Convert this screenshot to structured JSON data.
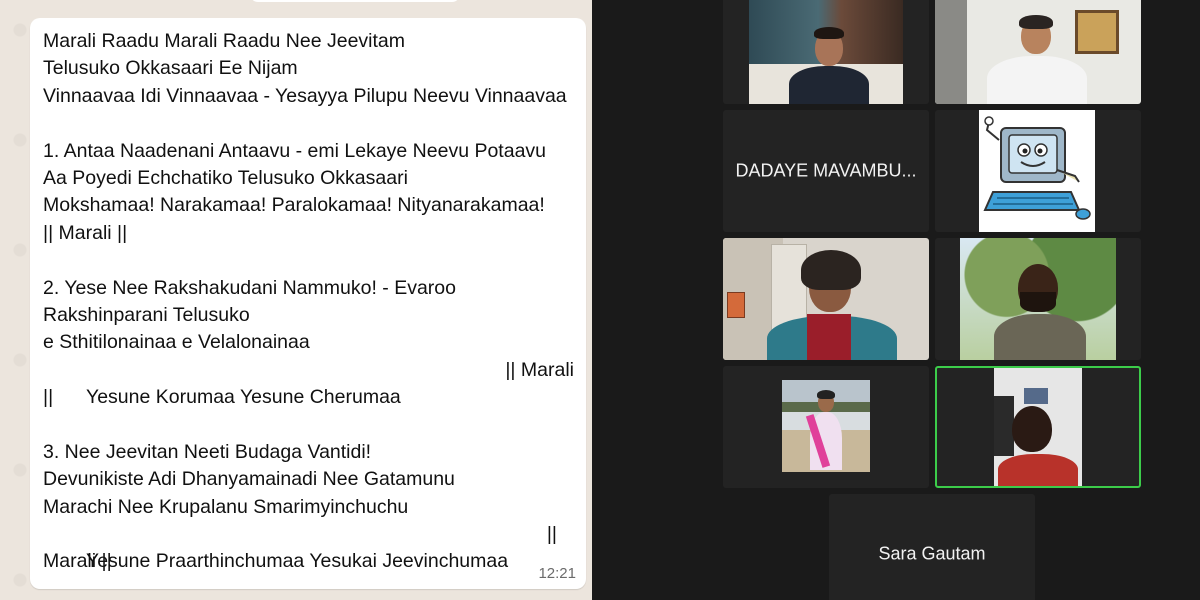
{
  "chat": {
    "message_lines": [
      "Marali Raadu Marali Raadu Nee Jeevitam",
      "Telusuko Okkasaari Ee Nijam",
      "Vinnaavaa Idi Vinnaavaa - Yesayya Pilupu Neevu Vinnaavaa",
      "",
      "1. Antaa Naadenani Antaavu - emi Lekaye Neevu Potaavu",
      "Aa Poyedi Echchatiko Telusuko Okkasaari",
      "Mokshamaa! Narakamaa! Paralokamaa! Nityanarakamaa!",
      "|| Marali ||",
      "",
      "2. Yese Nee Rakshakudani Nammuko! - Evaroo",
      "Rakshinparani Telusuko",
      "e Sthitilonainaa e Velalonainaa"
    ],
    "line_yesune_korumaa_left": "Yesune Korumaa Yesune Cherumaa",
    "line_yesune_korumaa_right": "|| Marali",
    "line_bars": "||",
    "message_lines_2": [
      "",
      "3. Nee Jeevitan Neeti Budaga Vantidi!",
      "Devunikiste Adi Dhanyamainadi Nee Gatamunu",
      "Marachi Nee Krupalanu Smarimyinchuchu"
    ],
    "line_praarthinchumaa_left": "Yesune Praarthinchumaa Yesukai Jeevinchumaa",
    "line_praarthinchumaa_right": "||",
    "line_last": "Marali ||",
    "timestamp": "12:21"
  },
  "video": {
    "participants": [
      {
        "id": "p1",
        "type": "video",
        "desc": "man-dark-shirt"
      },
      {
        "id": "p2",
        "type": "video",
        "desc": "woman-white-shrine"
      },
      {
        "id": "p3",
        "type": "name",
        "name": "DADAYE MAVAMBU..."
      },
      {
        "id": "p4",
        "type": "avatar",
        "desc": "computer-cartoon"
      },
      {
        "id": "p5",
        "type": "video",
        "desc": "man-red-scarf"
      },
      {
        "id": "p6",
        "type": "video",
        "desc": "man-under-tree"
      },
      {
        "id": "p7",
        "type": "video",
        "desc": "girl-sash"
      },
      {
        "id": "p8",
        "type": "video",
        "desc": "man-dim-room",
        "speaking": true
      },
      {
        "id": "p9",
        "type": "name",
        "name": "Sara Gautam"
      }
    ],
    "active_speaker_color": "#3ccc4a"
  }
}
